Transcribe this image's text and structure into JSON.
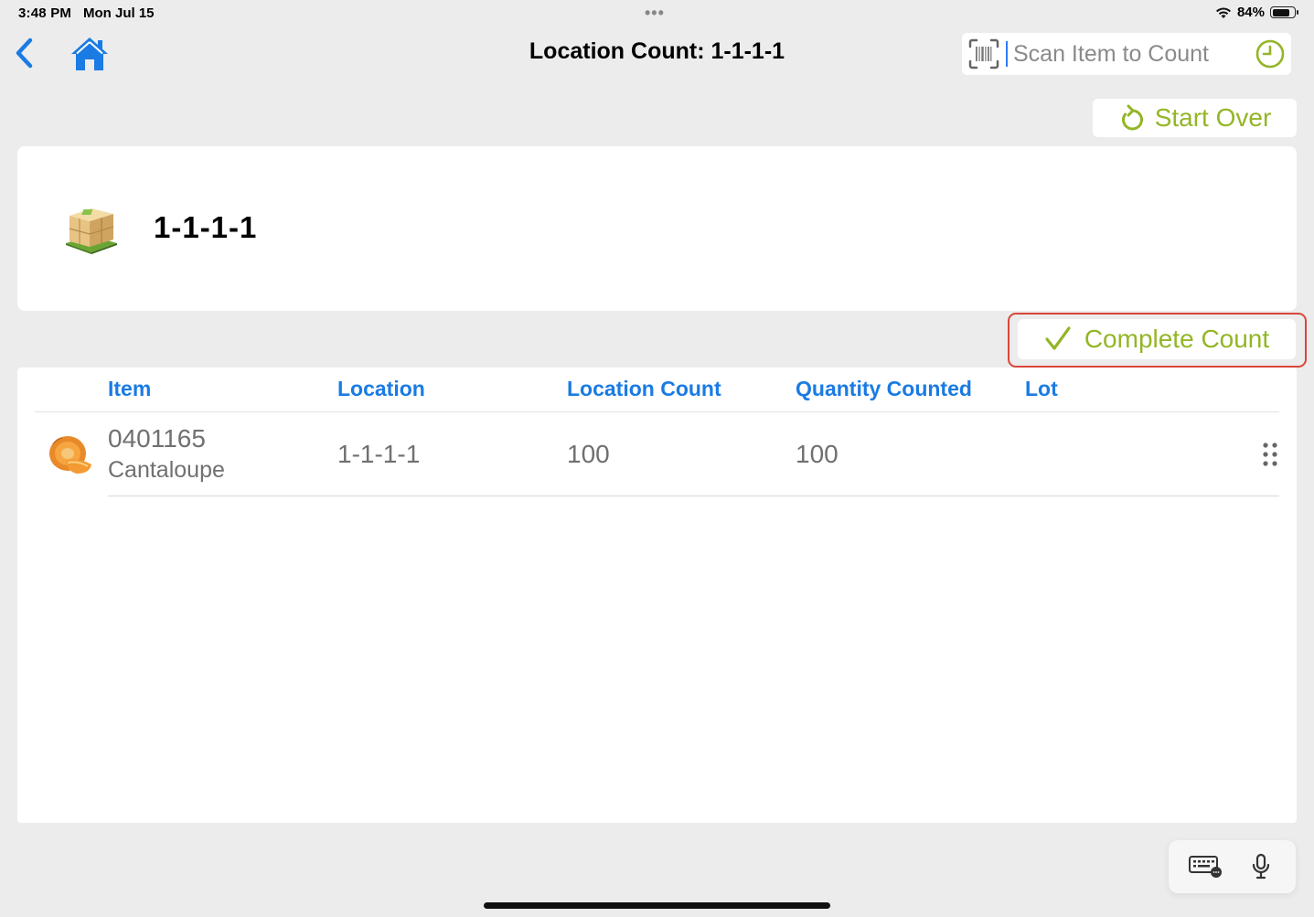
{
  "status_bar": {
    "time": "3:48 PM",
    "date": "Mon Jul 15",
    "battery": "84%",
    "battery_fraction": 0.84
  },
  "header": {
    "title": "Location Count: 1-1-1-1",
    "scan_placeholder": "Scan Item to Count",
    "scan_value": ""
  },
  "actions": {
    "start_over": "Start Over",
    "complete_count": "Complete Count"
  },
  "location": {
    "label": "1-1-1-1"
  },
  "table": {
    "columns": [
      "Item",
      "Location",
      "Location Count",
      "Quantity Counted",
      "Lot"
    ],
    "rows": [
      {
        "item_number": "0401165",
        "item_name": "Cantaloupe",
        "location": "1-1-1-1",
        "location_count": "100",
        "quantity_counted": "100",
        "lot": ""
      }
    ]
  },
  "colors": {
    "accent_green": "#93b626",
    "link_blue": "#1a7be3",
    "highlight_red": "#d9473a",
    "ios_blue": "#2e7cf6"
  }
}
